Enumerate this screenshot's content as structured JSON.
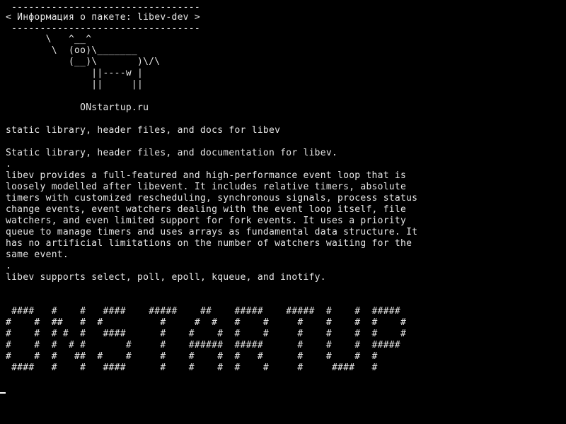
{
  "screen": {
    "background": "#000000",
    "foreground": "#e6e6e6",
    "cursor_color": "#ffffff"
  },
  "cowsay": {
    "top_border": " ---------------------------------",
    "speech": "< Информация о пакете: libev-dev >",
    "bottom_border": " ---------------------------------",
    "cow_line_1": "       \\   ^__^",
    "cow_line_2": "        \\  (oo)\\_______",
    "cow_line_3": "           (__)\\       )\\/\\",
    "cow_line_4": "               ||----w |",
    "cow_line_5": "               ||     ||",
    "site": "             ONstartup.ru"
  },
  "package": {
    "summary": "static library, header files, and docs for libev",
    "description_1": "Static library, header files, and documentation for libev.",
    "separator_1": ".",
    "description_2": "libev provides a full-featured and high-performance event loop that is",
    "description_3": "loosely modelled after libevent. It includes relative timers, absolute",
    "description_4": "timers with customized rescheduling, synchronous signals, process status",
    "description_5": "change events, event watchers dealing with the event loop itself, file",
    "description_6": "watchers, and even limited support for fork events. It uses a priority",
    "description_7": "queue to manage timers and uses arrays as fundamental data structure. It",
    "description_8": "has no artificial limitations on the number of watchers waiting for the",
    "description_9": "same event.",
    "separator_2": ".",
    "description_10": "libev supports select, poll, epoll, kqueue, and inotify."
  },
  "banner": {
    "row_1": " ####   #    #   ####    #####    ##    #####    #####  #    #  #####",
    "row_2": "#    #  ##   #  #          #     #  #   #    #     #    #    #  #    #",
    "row_3": "#    #  # #  #   ####      #    #    #  #    #     #    #    #  #    #",
    "row_4": "#    #  #  # #       #     #    ######  #####      #    #    #  #####",
    "row_5": "#    #  #   ##  #    #     #    #    #  #   #      #    #    #  #",
    "row_6": " ####   #    #   ####      #    #    #  #    #     #     ####   #"
  }
}
